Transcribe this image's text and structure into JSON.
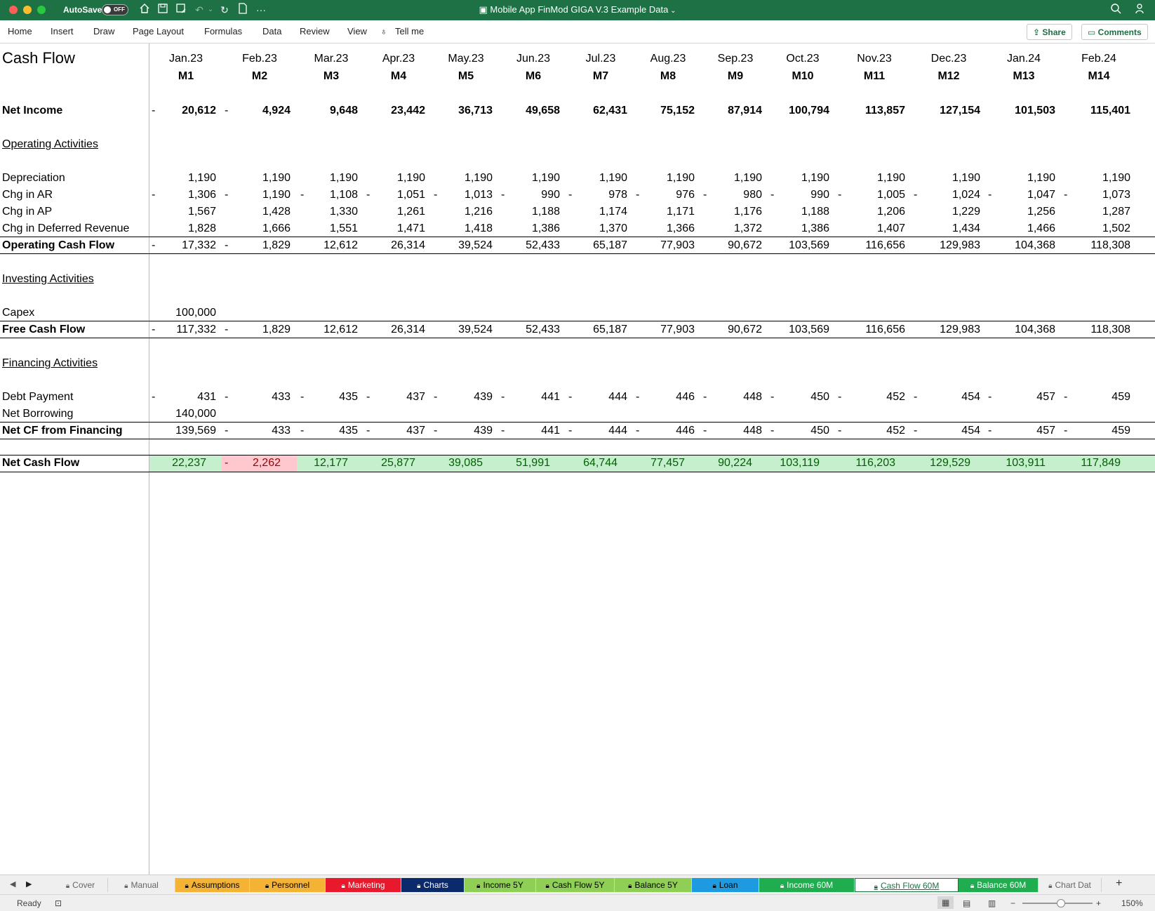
{
  "titlebar": {
    "autosave_label": "AutoSave",
    "autosave_state": "OFF",
    "document_title": "Mobile App FinMod GIGA V.3 Example Data",
    "icons": [
      "home-icon",
      "save-icon",
      "save-as-icon",
      "undo-icon",
      "redo-icon",
      "new-file-icon",
      "more-icon",
      "search-icon",
      "share-people-icon"
    ]
  },
  "ribbon": {
    "tabs": [
      "Home",
      "Insert",
      "Draw",
      "Page Layout",
      "Formulas",
      "Data",
      "Review",
      "View",
      "Tell me"
    ],
    "share_label": "Share",
    "comments_label": "Comments"
  },
  "sheet": {
    "title": "Cash Flow",
    "months": [
      "Jan.23",
      "Feb.23",
      "Mar.23",
      "Apr.23",
      "May.23",
      "Jun.23",
      "Jul.23",
      "Aug.23",
      "Sep.23",
      "Oct.23",
      "Nov.23",
      "Dec.23",
      "Jan.24",
      "Feb.24"
    ],
    "periods": [
      "M1",
      "M2",
      "M3",
      "M4",
      "M5",
      "M6",
      "M7",
      "M8",
      "M9",
      "M10",
      "M11",
      "M12",
      "M13",
      "M14"
    ],
    "rows": {
      "net_income": {
        "label": "Net Income",
        "values": [
          "20,612",
          "4,924",
          "9,648",
          "23,442",
          "36,713",
          "49,658",
          "62,431",
          "75,152",
          "87,914",
          "100,794",
          "113,857",
          "127,154",
          "101,503",
          "115,401"
        ],
        "negatives": [
          true,
          true,
          false,
          false,
          false,
          false,
          false,
          false,
          false,
          false,
          false,
          false,
          false,
          false
        ]
      },
      "operating_header": "Operating Activities",
      "depreciation": {
        "label": "Depreciation",
        "values": [
          "1,190",
          "1,190",
          "1,190",
          "1,190",
          "1,190",
          "1,190",
          "1,190",
          "1,190",
          "1,190",
          "1,190",
          "1,190",
          "1,190",
          "1,190",
          "1,190"
        ]
      },
      "chg_ar": {
        "label": "Chg in AR",
        "values": [
          "1,306",
          "1,190",
          "1,108",
          "1,051",
          "1,013",
          "990",
          "978",
          "976",
          "980",
          "990",
          "1,005",
          "1,024",
          "1,047",
          "1,073"
        ],
        "all_negative": true
      },
      "chg_ap": {
        "label": "Chg in AP",
        "values": [
          "1,567",
          "1,428",
          "1,330",
          "1,261",
          "1,216",
          "1,188",
          "1,174",
          "1,171",
          "1,176",
          "1,188",
          "1,206",
          "1,229",
          "1,256",
          "1,287"
        ]
      },
      "chg_deferred": {
        "label": "Chg in Deferred Revenue",
        "values": [
          "1,828",
          "1,666",
          "1,551",
          "1,471",
          "1,418",
          "1,386",
          "1,370",
          "1,366",
          "1,372",
          "1,386",
          "1,407",
          "1,434",
          "1,466",
          "1,502"
        ]
      },
      "operating_cf": {
        "label": "Operating Cash Flow",
        "values": [
          "17,332",
          "1,829",
          "12,612",
          "26,314",
          "39,524",
          "52,433",
          "65,187",
          "77,903",
          "90,672",
          "103,569",
          "116,656",
          "129,983",
          "104,368",
          "118,308"
        ],
        "negatives": [
          true,
          true,
          false,
          false,
          false,
          false,
          false,
          false,
          false,
          false,
          false,
          false,
          false,
          false
        ]
      },
      "investing_header": "Investing Activities",
      "capex": {
        "label": "Capex",
        "values": [
          "100,000"
        ]
      },
      "free_cf": {
        "label": "Free Cash Flow",
        "values": [
          "117,332",
          "1,829",
          "12,612",
          "26,314",
          "39,524",
          "52,433",
          "65,187",
          "77,903",
          "90,672",
          "103,569",
          "116,656",
          "129,983",
          "104,368",
          "118,308"
        ],
        "negatives": [
          true,
          true,
          false,
          false,
          false,
          false,
          false,
          false,
          false,
          false,
          false,
          false,
          false,
          false
        ]
      },
      "financing_header": "Financing Activities",
      "debt_payment": {
        "label": "Debt Payment",
        "values": [
          "431",
          "433",
          "435",
          "437",
          "439",
          "441",
          "444",
          "446",
          "448",
          "450",
          "452",
          "454",
          "457",
          "459"
        ],
        "all_negative": true
      },
      "net_borrowing": {
        "label": "Net Borrowing",
        "values": [
          "140,000"
        ]
      },
      "net_cf_financing": {
        "label": "Net CF from Financing",
        "values": [
          "139,569",
          "433",
          "435",
          "437",
          "439",
          "441",
          "444",
          "446",
          "448",
          "450",
          "452",
          "454",
          "457",
          "459"
        ],
        "negatives": [
          false,
          true,
          true,
          true,
          true,
          true,
          true,
          true,
          true,
          true,
          true,
          true,
          true,
          true
        ]
      },
      "net_cash_flow": {
        "label": "Net Cash Flow",
        "values": [
          "22,237",
          "2,262",
          "12,177",
          "25,877",
          "39,085",
          "51,991",
          "64,744",
          "77,457",
          "90,224",
          "103,119",
          "116,203",
          "129,529",
          "103,911",
          "117,849"
        ],
        "negatives": [
          false,
          true,
          false,
          false,
          false,
          false,
          false,
          false,
          false,
          false,
          false,
          false,
          false,
          false
        ]
      }
    },
    "colors": {
      "positive_fill": "#c6efce",
      "positive_text": "#006100",
      "negative_fill": "#ffc7ce",
      "negative_text": "#9c0006"
    }
  },
  "sheet_tabs": [
    {
      "label": "Cover",
      "locked": true,
      "bg": "#efefef",
      "fg": "#666666"
    },
    {
      "label": "Manual",
      "locked": true,
      "bg": "#efefef",
      "fg": "#666666"
    },
    {
      "label": "Assumptions",
      "locked": true,
      "bg": "#f5b335",
      "fg": "#000000"
    },
    {
      "label": "Personnel",
      "locked": true,
      "bg": "#f5b335",
      "fg": "#000000"
    },
    {
      "label": "Marketing",
      "locked": true,
      "bg": "#e8192c",
      "fg": "#ffffff"
    },
    {
      "label": "Charts",
      "locked": true,
      "bg": "#0b2a6b",
      "fg": "#ffffff"
    },
    {
      "label": "Income 5Y",
      "locked": true,
      "bg": "#8fcf55",
      "fg": "#000000"
    },
    {
      "label": "Cash Flow 5Y",
      "locked": true,
      "bg": "#8fcf55",
      "fg": "#000000"
    },
    {
      "label": "Balance 5Y",
      "locked": true,
      "bg": "#8fcf55",
      "fg": "#000000"
    },
    {
      "label": "Loan",
      "locked": true,
      "bg": "#1e9be0",
      "fg": "#000000"
    },
    {
      "label": "Income 60M",
      "locked": true,
      "bg": "#1fad4f",
      "fg": "#ffffff"
    },
    {
      "label": "Cash Flow 60M",
      "locked": true,
      "bg": "#ffffff",
      "fg": "#1e7145"
    },
    {
      "label": "Balance 60M",
      "locked": true,
      "bg": "#1fad4f",
      "fg": "#ffffff"
    },
    {
      "label": "Chart Dat",
      "locked": true,
      "bg": "#efefef",
      "fg": "#666666"
    }
  ],
  "statusbar": {
    "ready": "Ready",
    "zoom": "150%"
  }
}
